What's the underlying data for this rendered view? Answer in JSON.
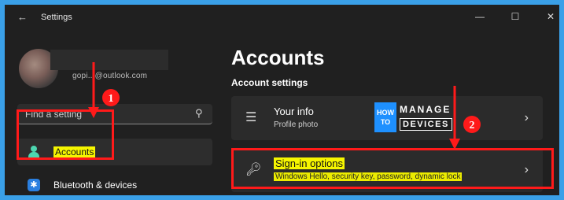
{
  "window": {
    "title": "Settings",
    "back_icon": "back-arrow-icon",
    "minimize_glyph": "—",
    "maximize_glyph": "☐",
    "close_glyph": "✕"
  },
  "user": {
    "email": "gopi...@outlook.com"
  },
  "search": {
    "placeholder": "Find a setting",
    "icon": "search-icon"
  },
  "sidebar": {
    "items": [
      {
        "label": "Accounts",
        "icon": "person-icon",
        "selected": true
      },
      {
        "label": "Bluetooth & devices",
        "icon": "bluetooth-icon",
        "selected": false
      }
    ]
  },
  "main": {
    "title": "Accounts",
    "section": "Account settings",
    "cards": [
      {
        "title": "Your info",
        "subtitle": "Profile photo",
        "icon": "person-card-icon"
      },
      {
        "title": "Sign-in options",
        "subtitle": "Windows Hello, security key, password, dynamic lock",
        "icon": "key-icon"
      }
    ]
  },
  "logo": {
    "how": "HOW TO",
    "manage": "MANAGE",
    "devices": "DEVICES"
  },
  "annotations": {
    "step1": "1",
    "step2": "2",
    "color": "#ff1a1a"
  },
  "colors": {
    "background": "#202020",
    "highlight": "#f6f600",
    "accent": "#4dd6b0",
    "border": "#3aa0e8"
  }
}
